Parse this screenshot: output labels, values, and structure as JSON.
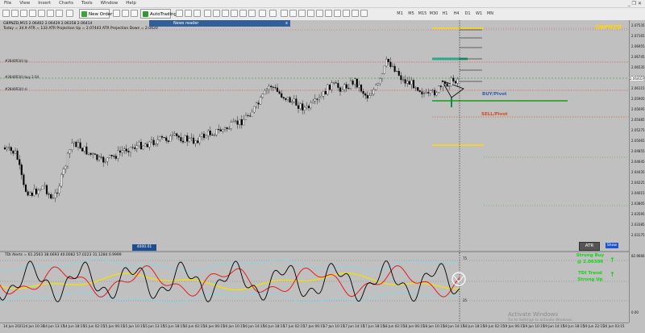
{
  "menu": [
    "File",
    "View",
    "Insert",
    "Charts",
    "Tools",
    "Window",
    "Help"
  ],
  "toolbar": {
    "new_order": "New Order",
    "auto_trading": "AutoTrading",
    "timeframes": [
      "M1",
      "M5",
      "M15",
      "M30",
      "H1",
      "H4",
      "D1",
      "W1",
      "MN"
    ]
  },
  "chart": {
    "symbol_info": "GBPNZD,M15  2.06402 2.06429 2.06358 2.06414",
    "info_line2": "Today = 34.9   ATR = 133   ATR Projection Up = 2.07443   ATR Projection Down = 2.0420",
    "pair_label": "GBPNZD",
    "buy_pivot_label": "BUY/Pivot",
    "sell_pivot_label": "SELL/Pivot",
    "level_labels": [
      "#2840R3(I) tp",
      "#2840R3(I) buy 2.04",
      "#2840R3(I) sl"
    ],
    "bottom_tag": "4000.01",
    "atr_button": "ATR",
    "show_button": "Show"
  },
  "news_reader": {
    "title": "News reader",
    "close": "x"
  },
  "price_axis": {
    "labels": [
      "2.07535",
      "2.07165",
      "2.06955",
      "2.06745",
      "2.06535",
      "2.06325",
      "2.06115",
      "2.05905",
      "2.05695",
      "2.05485",
      "2.05275",
      "2.05065",
      "2.04855",
      "2.04645",
      "2.04435",
      "2.04225",
      "2.04015",
      "2.03805",
      "2.03595",
      "2.03385",
      "2.03175"
    ],
    "current_price": "2.06402",
    "indicator_labels": [
      "82.9666",
      "0.00"
    ]
  },
  "time_axis": {
    "labels": [
      "14 Jun 2021",
      "14 Jun 10:30",
      "14 Jun 13:15",
      "14 Jun 18:15",
      "15 Jun 02:15",
      "15 Jun 06:15",
      "15 Jun 10:15",
      "15 Jun 13:15",
      "15 Jun 18:15",
      "16 Jun 02:15",
      "16 Jun 06:15",
      "16 Jun 10:15",
      "16 Jun 14:15",
      "16 Jun 18:15",
      "17 Jun 02:15",
      "17 Jun 06:15",
      "17 Jun 10:15",
      "17 Jun 14:15",
      "17 Jun 18:15",
      "18 Jun 02:15",
      "18 Jun 06:15",
      "18 Jun 10:15",
      "18 Jun 14:15",
      "18 Jun 18:15",
      "19 Jun 02:15",
      "19 Jun 06:15",
      "19 Jun 10:15",
      "19 Jun 14:15",
      "19 Jun 18:15",
      "19 Jun 22:15",
      "20 Jun 03:15"
    ]
  },
  "tdi": {
    "label": "TDI Alerts = 61.2563 38.6693 40.0082 57.0223 31.1284 0.9999",
    "level_top": "75",
    "level_bottom": "25",
    "strong_buy": "Strong Buy",
    "strong_buy_price": "@ 2.06386",
    "trend_title": "TDI Trend",
    "trend_value": "Strong Up"
  },
  "watermark": {
    "line1": "Activate Windows",
    "line2": "Go to Settings to activate Windows."
  },
  "colors": {
    "bg": "#c0c0c0",
    "up_candle": "#ffffff",
    "down_candle": "#000000",
    "gold": "#ffd700",
    "blue": "#2d60b0",
    "orange": "#d24b14",
    "green": "#12d412",
    "red_line": "#d23c3c"
  }
}
